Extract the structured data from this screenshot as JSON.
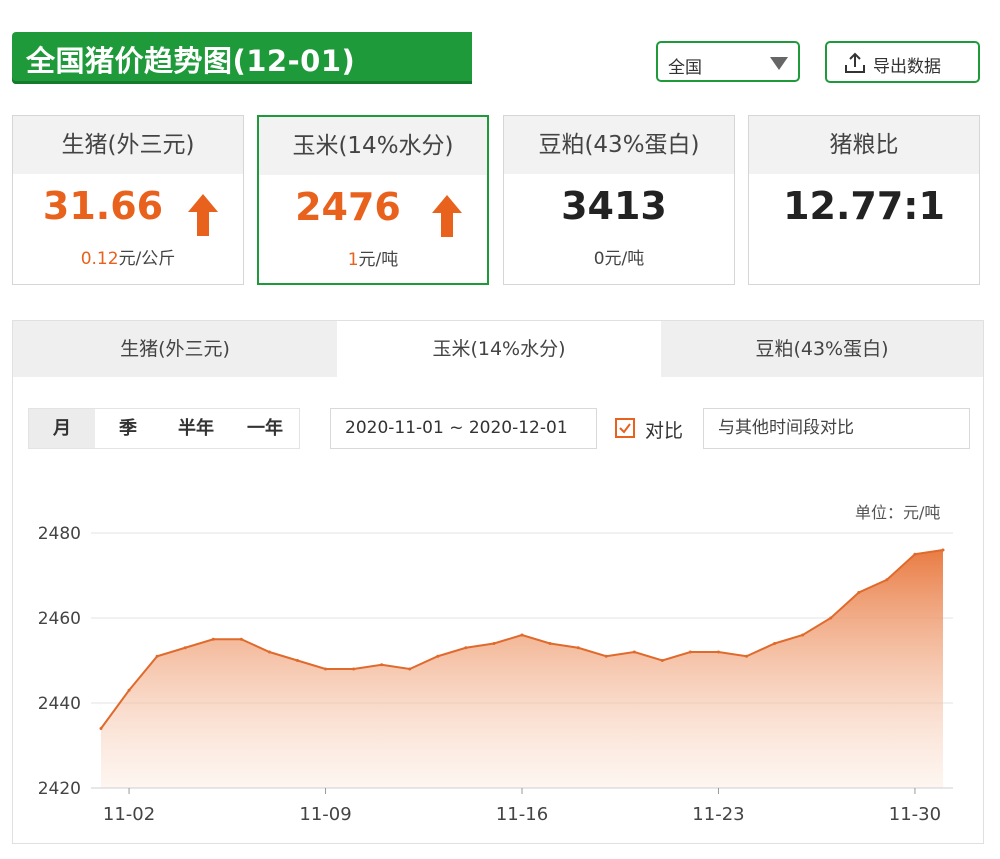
{
  "title": "全国猪价趋势图(12-01)",
  "region_select": {
    "value": "全国"
  },
  "export_button": {
    "label": "导出数据"
  },
  "cards": [
    {
      "name": "生猪(外三元)",
      "value": "31.66",
      "delta_num": "0.12",
      "delta_unit": "元/公斤",
      "trend": "up",
      "value_color": "#e8621d"
    },
    {
      "name": "玉米(14%水分)",
      "value": "2476",
      "delta_num": "1",
      "delta_unit": "元/吨",
      "trend": "up",
      "value_color": "#e8621d"
    },
    {
      "name": "豆粕(43%蛋白)",
      "value": "3413",
      "delta_num": "0",
      "delta_unit": "元/吨",
      "trend": "flat",
      "value_color": "#222222"
    },
    {
      "name": "猪粮比",
      "value": "12.77:1"
    }
  ],
  "tabs": [
    "生猪(外三元)",
    "玉米(14%水分)",
    "豆粕(43%蛋白)"
  ],
  "periods": [
    "月",
    "季",
    "半年",
    "一年"
  ],
  "date_range": "2020-11-01 ~ 2020-12-01",
  "compare": {
    "label": "对比",
    "checked": true,
    "placeholder": "与其他时间段对比"
  },
  "colors": {
    "brand_green": "#1f9a3a",
    "accent_orange": "#e8621d",
    "area_fill": "#e8753a"
  },
  "chart_data": {
    "type": "area",
    "unit_label": "单位：元/吨",
    "x": [
      "11-01",
      "11-02",
      "11-03",
      "11-04",
      "11-05",
      "11-06",
      "11-07",
      "11-08",
      "11-09",
      "11-10",
      "11-11",
      "11-12",
      "11-13",
      "11-14",
      "11-15",
      "11-16",
      "11-17",
      "11-18",
      "11-19",
      "11-20",
      "11-21",
      "11-22",
      "11-23",
      "11-24",
      "11-25",
      "11-26",
      "11-27",
      "11-28",
      "11-29",
      "11-30",
      "12-01"
    ],
    "series": [
      {
        "values": [
          2434,
          2443,
          2451,
          2453,
          2455,
          2455,
          2452,
          2450,
          2448,
          2448,
          2449,
          2448,
          2451,
          2453,
          2454,
          2456,
          2454,
          2453,
          2451,
          2452,
          2450,
          2452,
          2452,
          2451,
          2454,
          2456,
          2460,
          2466,
          2469,
          2475,
          2476
        ]
      }
    ],
    "x_tick_labels": [
      "11-02",
      "11-09",
      "11-16",
      "11-23",
      "11-30"
    ],
    "y_ticks": [
      2420,
      2440,
      2460,
      2480
    ],
    "ylim": [
      2420,
      2480
    ],
    "grid": true
  }
}
